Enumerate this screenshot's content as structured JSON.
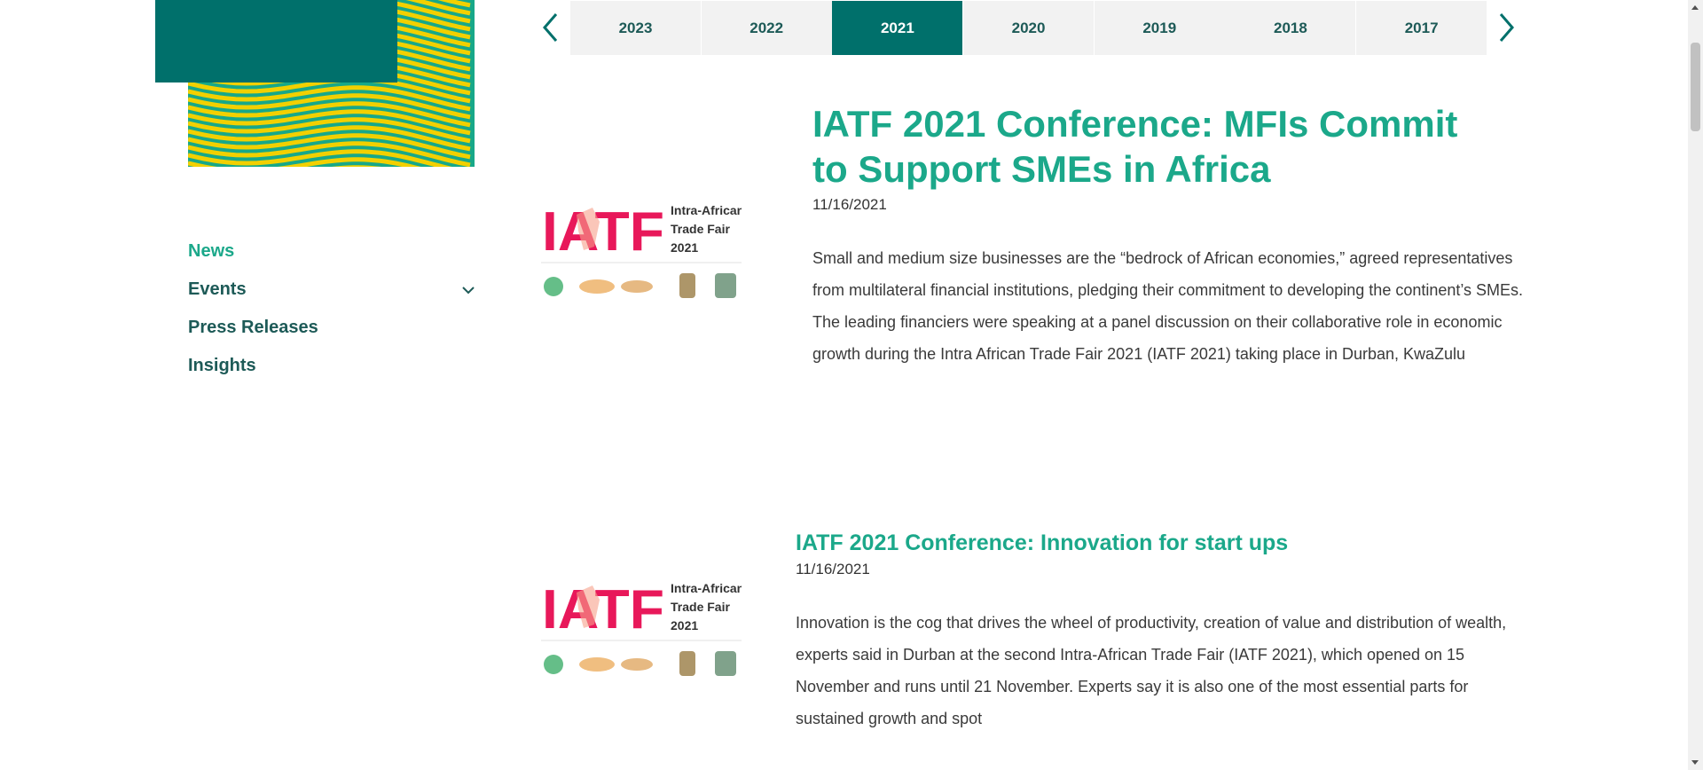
{
  "sidebar": {
    "items": [
      {
        "label": "News",
        "active": true
      },
      {
        "label": "Events",
        "has_dropdown": true
      },
      {
        "label": "Press Releases"
      },
      {
        "label": "Insights"
      }
    ]
  },
  "years": {
    "tabs": [
      "2023",
      "2022",
      "2021",
      "2020",
      "2019",
      "2018",
      "2017"
    ],
    "active": "2021"
  },
  "articles": [
    {
      "title": "IATF 2021 Conference: MFIs Commit to Support SMEs in Africa",
      "date": "11/16/2021",
      "excerpt": "Small and medium size businesses are the “bedrock of African economies,” agreed representatives from multilateral financial institutions, pledging their commitment to developing the continent’s SMEs. The leading financiers were speaking at a panel discussion on their collaborative role in economic growth during the Intra African Trade Fair 2021 (IATF 2021) taking place in Durban, KwaZulu",
      "thumbnail": {
        "logo_text": "IATF",
        "side_text_1": "Intra-African",
        "side_text_2": "Trade Fair",
        "side_text_3": "2021"
      }
    },
    {
      "title": "IATF 2021 Conference: Innovation for start ups",
      "date": "11/16/2021",
      "excerpt": "Innovation is the cog that drives the wheel of productivity, creation of value and distribution of wealth, experts said in Durban at the second Intra-African Trade Fair (IATF 2021), which opened on 15 November and runs until 21 November. Experts say it is also one of the most essential parts for sustained growth and spot",
      "thumbnail": {
        "logo_text": "IATF",
        "side_text_1": "Intra-African",
        "side_text_2": "Trade Fair",
        "side_text_3": "2021"
      }
    }
  ],
  "colors": {
    "brand_teal": "#00706b",
    "accent_green": "#1ba88a",
    "stripe_yellow": "#f2d000",
    "stripe_green": "#17a889",
    "logo_red": "#e8185a"
  }
}
